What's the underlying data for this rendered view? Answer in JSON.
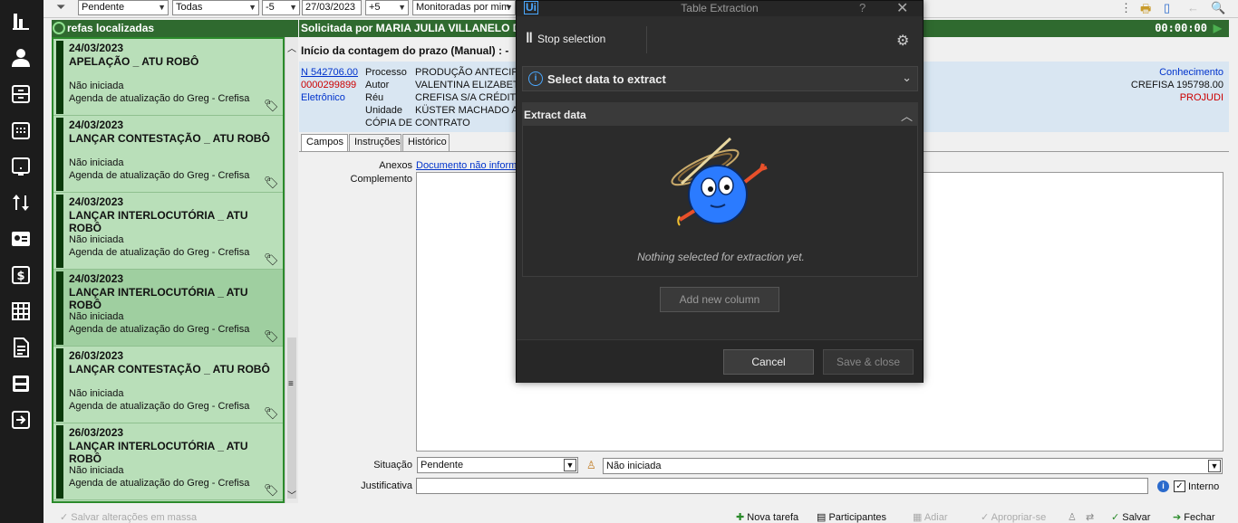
{
  "filters": {
    "status_value": "Pendente",
    "scope_value": "Todas",
    "offset_value": "-5",
    "date_value": "27/03/2023",
    "plus_value": "+5",
    "monitor_value": "Monitoradas por mim"
  },
  "tasks_panel": {
    "header": "Tarefas localizadas",
    "header_visible": "refas localizadas",
    "tasks": [
      {
        "date": "24/03/2023",
        "title": "APELAÇÃO _ ATU ROBÔ",
        "status": "Não iniciada",
        "agenda": "Agenda de atualização do Greg - Crefisa"
      },
      {
        "date": "24/03/2023",
        "title": "LANÇAR CONTESTAÇÃO _ ATU ROBÔ",
        "status": "Não iniciada",
        "agenda": "Agenda de atualização do Greg - Crefisa"
      },
      {
        "date": "24/03/2023",
        "title": "LANÇAR INTERLOCUTÓRIA _ ATU ROBÔ",
        "status": "Não iniciada",
        "agenda": "Agenda de atualização do Greg - Crefisa"
      },
      {
        "date": "24/03/2023",
        "title": "LANÇAR INTERLOCUTÓRIA _ ATU ROBÔ",
        "status": "Não iniciada",
        "agenda": "Agenda de atualização do Greg - Crefisa"
      },
      {
        "date": "26/03/2023",
        "title": "LANÇAR CONTESTAÇÃO _ ATU ROBÔ",
        "status": "Não iniciada",
        "agenda": "Agenda de atualização do Greg - Crefisa"
      },
      {
        "date": "26/03/2023",
        "title": "LANÇAR INTERLOCUTÓRIA _ ATU ROBÔ",
        "status": "Não iniciada",
        "agenda": "Agenda de atualização do Greg - Crefisa"
      }
    ]
  },
  "detail": {
    "header": "Solicitada por MARIA JULIA VILLANELO D",
    "timer": "00:00:00",
    "start_label": "Início da contagem do prazo (Manual) :  -",
    "process_number": "N 542706.00",
    "red_number": "0000299899",
    "electronic": "Eletrônico",
    "labels": {
      "processo": "Processo",
      "autor": "Autor",
      "reu": "Réu",
      "unidade": "Unidade"
    },
    "values": {
      "processo": "PRODUÇÃO ANTECIPA",
      "autor": "VALENTINA ELIZABETH",
      "reu": "CREFISA S/A CRÉDITO",
      "unidade": "KÜSTER MACHADO ADV",
      "extra": "CÓPIA DE CONTRATO"
    },
    "right": {
      "conhecimento": "Conhecimento",
      "crefisa": "CREFISA 195798.00",
      "projudi": "PROJUDI"
    },
    "tabs": [
      "Campos",
      "Instruções",
      "Histórico"
    ],
    "fields": {
      "anexos_label": "Anexos",
      "anexos_link": "Documento não informa",
      "complemento_label": "Complemento",
      "situacao_label": "Situação",
      "situacao_value": "Pendente",
      "status_value": "Não iniciada",
      "justificativa_label": "Justificativa",
      "interno_label": "Interno"
    }
  },
  "bottom": {
    "salvar_massa": "Salvar alterações em massa",
    "nova_tarefa": "Nova tarefa",
    "participantes": "Participantes",
    "adiar": "Adiar",
    "apropriar": "Apropriar-se",
    "salvar": "Salvar",
    "fechar": "Fechar"
  },
  "dialog": {
    "logo": "Ui",
    "title": "Table Extraction",
    "help": "?",
    "close": "✕",
    "stop_selection": "Stop selection",
    "select_data": "Select data to extract",
    "extract_data": "Extract data",
    "empty_message": "Nothing selected for extraction yet.",
    "add_column": "Add new column",
    "cancel": "Cancel",
    "save_close": "Save & close"
  },
  "colors": {
    "green_header": "#2f6a2f",
    "task_bg": "#b9dfb9",
    "dialog_bg": "#2d2d2d",
    "accent_blue": "#4aa8ff"
  }
}
